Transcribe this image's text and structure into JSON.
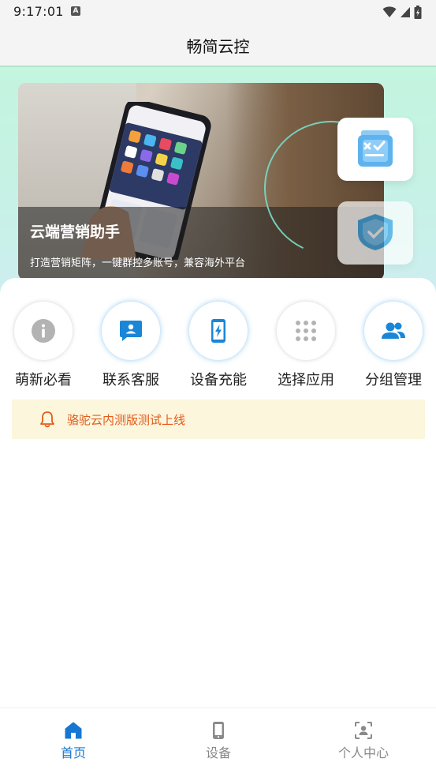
{
  "status_bar": {
    "time": "9:17:01",
    "notification_glyph": "A",
    "icons": [
      "wifi-icon",
      "signal-icon",
      "battery-icon"
    ]
  },
  "app_bar": {
    "title": "畅简云控"
  },
  "banner": {
    "title": "云端营销助手",
    "subtitle": "打造营销矩阵，一键群控多账号，兼容海外平台"
  },
  "quick_actions": [
    {
      "label": "萌新必看",
      "icon": "info-icon"
    },
    {
      "label": "联系客服",
      "icon": "contact-card-icon"
    },
    {
      "label": "设备充能",
      "icon": "phone-charge-icon"
    },
    {
      "label": "选择应用",
      "icon": "app-grid-icon"
    },
    {
      "label": "分组管理",
      "icon": "group-icon"
    }
  ],
  "notice": {
    "icon": "bell-icon",
    "text": "骆驼云内测版测试上线"
  },
  "bottom_nav": [
    {
      "label": "首页",
      "icon": "home-icon",
      "active": true
    },
    {
      "label": "设备",
      "icon": "device-icon",
      "active": false
    },
    {
      "label": "个人中心",
      "icon": "profile-icon",
      "active": false
    }
  ],
  "colors": {
    "accent": "#1677d2",
    "icon_blue": "#1a86d8",
    "notice_bg": "#fbf6dc",
    "notice_text": "#e55a1c",
    "hero_bg": "#c3f5df"
  }
}
